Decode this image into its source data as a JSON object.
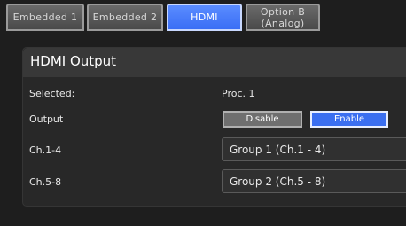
{
  "tabs": [
    {
      "label": "Embedded 1",
      "active": false
    },
    {
      "label": "Embedded 2",
      "active": false
    },
    {
      "label": "HDMI",
      "active": true
    },
    {
      "label": "Option B\n(Analog)",
      "active": false
    }
  ],
  "panel": {
    "title": "HDMI Output",
    "rows": {
      "selected": {
        "label": "Selected:",
        "value": "Proc. 1"
      },
      "output": {
        "label": "Output",
        "disable_label": "Disable",
        "enable_label": "Enable",
        "state": "Enable"
      },
      "ch1_4": {
        "label": "Ch.1-4",
        "value": "Group 1 (Ch.1 - 4)"
      },
      "ch5_8": {
        "label": "Ch.5-8",
        "value": "Group 2 (Ch.5 - 8)"
      }
    }
  },
  "colors": {
    "accent": "#3b6ff0",
    "background": "#1e1e1e",
    "panel": "#282828"
  }
}
